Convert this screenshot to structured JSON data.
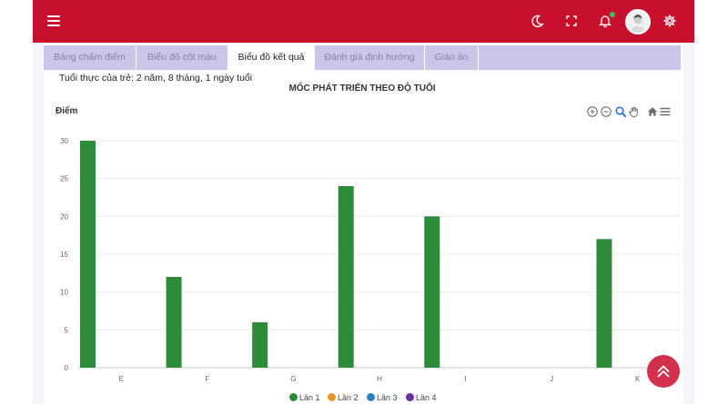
{
  "tabs": [
    {
      "label": "Bảng chấm điểm",
      "active": false
    },
    {
      "label": "Biểu đồ cột màu",
      "active": false
    },
    {
      "label": "Biểu đồ kết quả",
      "active": true
    },
    {
      "label": "Đánh giá định hướng",
      "active": false
    },
    {
      "label": "Giáo án",
      "active": false
    }
  ],
  "page": {
    "age_text": "Tuổi thực của trẻ: 2 năm, 8 tháng, 1 ngày tuổi"
  },
  "topbar": {
    "icons": [
      "menu-icon",
      "moon-icon",
      "fullscreen-icon",
      "bell-icon",
      "avatar",
      "gear-icon"
    ],
    "accent": "#c8102e"
  },
  "chart_data": {
    "type": "bar",
    "title": "MỐC PHÁT TRIỂN THEO ĐỘ TUỔI",
    "ylabel": "Điểm",
    "xlabel": "",
    "categories": [
      "E",
      "F",
      "G",
      "H",
      "I",
      "J",
      "K"
    ],
    "ylim": [
      0,
      30
    ],
    "yticks": [
      0,
      5,
      10,
      15,
      20,
      25,
      30
    ],
    "grid": true,
    "legend_position": "bottom-center",
    "series": [
      {
        "name": "Lần 1",
        "color": "#2e8b3a",
        "values": [
          30,
          12,
          6,
          24,
          20,
          0,
          17
        ]
      },
      {
        "name": "Lần 2",
        "color": "#f0922b",
        "values": [
          0,
          0,
          0,
          0,
          0,
          0,
          0
        ]
      },
      {
        "name": "Lần 3",
        "color": "#2d7fc1",
        "values": [
          0,
          0,
          0,
          0,
          0,
          0,
          0
        ]
      },
      {
        "name": "Lần 4",
        "color": "#6b2fa3",
        "values": [
          0,
          0,
          0,
          0,
          0,
          0,
          0
        ]
      }
    ]
  },
  "chart_toolbar": [
    "zoom-in-icon",
    "zoom-out-icon",
    "zoom-search-icon",
    "pan-hand-icon",
    "home-icon",
    "menu-icon"
  ],
  "fab": {
    "icon": "chevrons-up-icon",
    "color": "#d2304d"
  }
}
